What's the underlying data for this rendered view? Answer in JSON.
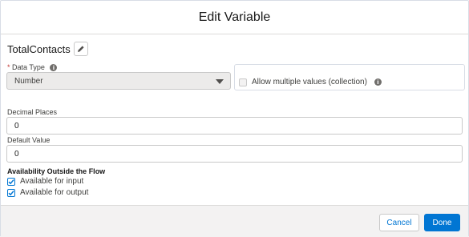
{
  "modal": {
    "title": "Edit Variable"
  },
  "variable": {
    "name": "TotalContacts"
  },
  "data_type": {
    "required_marker": "*",
    "label": "Data Type",
    "selected": "Number"
  },
  "multiple_values": {
    "label": "Allow multiple values (collection)",
    "checked": false
  },
  "decimal_places": {
    "label": "Decimal Places",
    "value": "0"
  },
  "default_value": {
    "label": "Default Value",
    "value": "0"
  },
  "availability": {
    "title": "Availability Outside the Flow",
    "input_label": "Available for input",
    "input_checked": true,
    "output_label": "Available for output",
    "output_checked": true
  },
  "footer": {
    "cancel_label": "Cancel",
    "done_label": "Done"
  },
  "colors": {
    "brand": "#0176d3",
    "required": "#c23934",
    "footer_bg": "#f3f2f2"
  },
  "icons": {
    "edit": "pencil-icon",
    "info": "info-icon",
    "dropdown": "chevron-down-icon",
    "check": "checkmark-icon"
  }
}
